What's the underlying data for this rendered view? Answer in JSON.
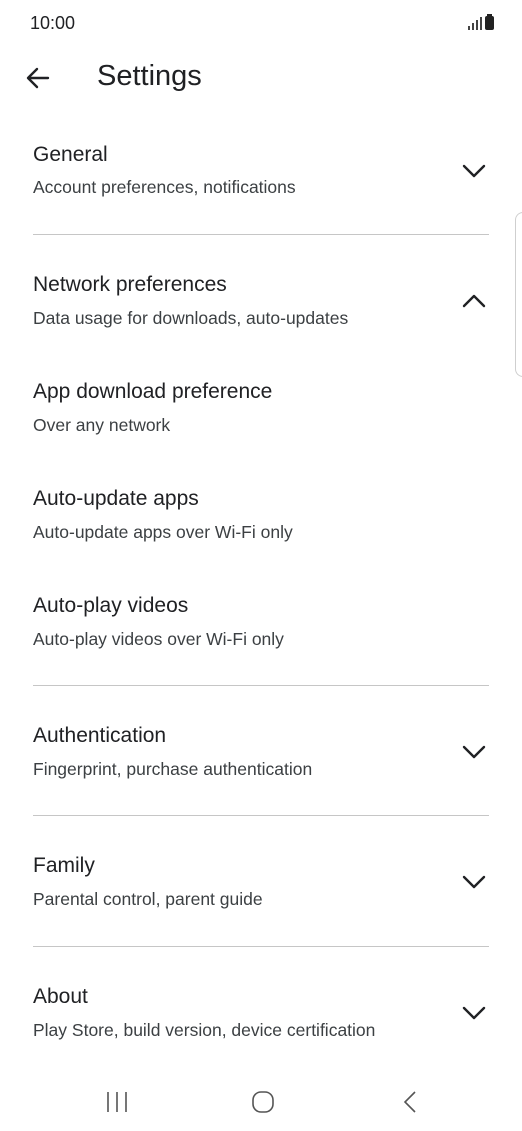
{
  "status_bar": {
    "time": "10:00",
    "signal_icon": "signal-bars-icon",
    "battery_icon": "battery-icon"
  },
  "app_bar": {
    "back_icon": "arrow-back-icon",
    "title": "Settings"
  },
  "sections": [
    {
      "title": "General",
      "subtitle": "Account preferences, notifications",
      "expanded": false
    },
    {
      "title": "Network preferences",
      "subtitle": "Data usage for downloads, auto-updates",
      "expanded": true,
      "children": [
        {
          "title": "App download preference",
          "subtitle": "Over any network"
        },
        {
          "title": "Auto-update apps",
          "subtitle": "Auto-update apps over Wi-Fi only"
        },
        {
          "title": "Auto-play videos",
          "subtitle": "Auto-play videos over Wi-Fi only"
        }
      ]
    },
    {
      "title": "Authentication",
      "subtitle": "Fingerprint, purchase authentication",
      "expanded": false
    },
    {
      "title": "Family",
      "subtitle": "Parental control, parent guide",
      "expanded": false
    },
    {
      "title": "About",
      "subtitle": "Play Store, build version, device certification",
      "expanded": false
    }
  ],
  "nav_bar": {
    "recents_icon": "recents-icon",
    "home_icon": "home-icon",
    "back_icon": "nav-back-icon"
  },
  "colors": {
    "text_primary": "#202124",
    "text_secondary": "#3c4043",
    "divider": "#c6c6c6",
    "background": "#ffffff"
  }
}
